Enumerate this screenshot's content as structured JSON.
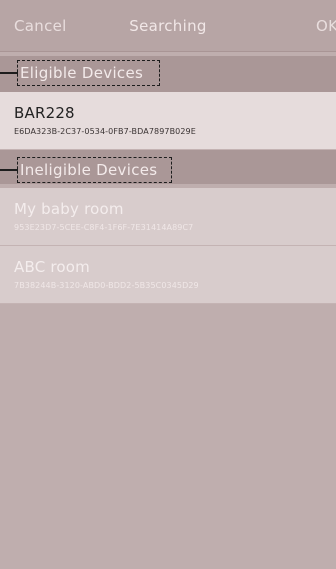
{
  "nav": {
    "cancel_label": "Cancel",
    "title": "Searching",
    "ok_label": "OK"
  },
  "sections": {
    "eligible": {
      "title": "Eligible Devices",
      "devices": [
        {
          "name": "BAR228",
          "id": "E6DA323B-2C37-0534-0FB7-BDA7897B029E"
        }
      ]
    },
    "ineligible": {
      "title": "Ineligible Devices",
      "devices": [
        {
          "name": "My baby room",
          "id": "953E23D7-5CEE-C8F4-1F6F-7E31414A89C7"
        },
        {
          "name": "ABC room",
          "id": "7B38244B-3120-ABD0-BDD2-5B35C0345D29"
        }
      ]
    }
  },
  "colors": {
    "background": "#bfaeae",
    "nav_bar": "#b7a5a5",
    "section_header": "#aa9797",
    "eligible_row": "#e6dcdc",
    "ineligible_row": "#d8cccc",
    "annotation": "#1d1d1d"
  }
}
